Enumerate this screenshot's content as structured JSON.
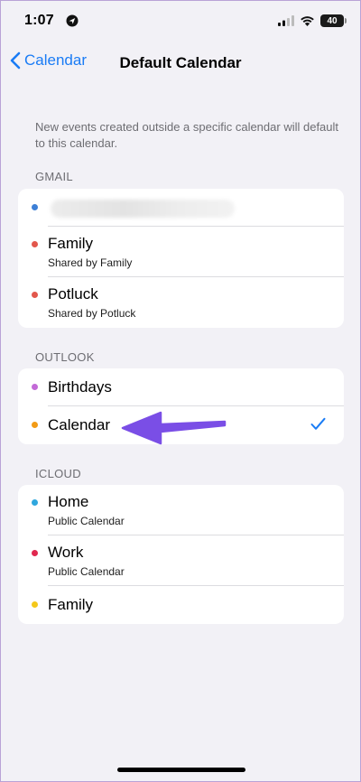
{
  "status_bar": {
    "time": "1:07",
    "battery": "40"
  },
  "nav": {
    "back_label": "Calendar",
    "title": "Default Calendar"
  },
  "description": "New events created outside a specific calendar will default to this calendar.",
  "sections": {
    "gmail": {
      "header": "GMAIL",
      "items": [
        {
          "title": "",
          "dot_color": "#3d7fd6"
        },
        {
          "title": "Family",
          "subtitle": "Shared by Family",
          "dot_color": "#e2574c"
        },
        {
          "title": "Potluck",
          "subtitle": "Shared by Potluck",
          "dot_color": "#e2574c"
        }
      ]
    },
    "outlook": {
      "header": "OUTLOOK",
      "items": [
        {
          "title": "Birthdays",
          "dot_color": "#c36ad7"
        },
        {
          "title": "Calendar",
          "dot_color": "#f29b16",
          "selected": true
        }
      ]
    },
    "icloud": {
      "header": "ICLOUD",
      "items": [
        {
          "title": "Home",
          "subtitle": "Public Calendar",
          "dot_color": "#2fa7de"
        },
        {
          "title": "Work",
          "subtitle": "Public Calendar",
          "dot_color": "#e0284f"
        },
        {
          "title": "Family",
          "dot_color": "#f4c81b"
        }
      ]
    }
  },
  "colors": {
    "accent": "#1a7cf5",
    "annotation_arrow": "#7a4ee6"
  },
  "icons": {
    "back": "chevron-left-icon",
    "selected": "checkmark-icon",
    "annotation": "arrow-left-icon"
  }
}
